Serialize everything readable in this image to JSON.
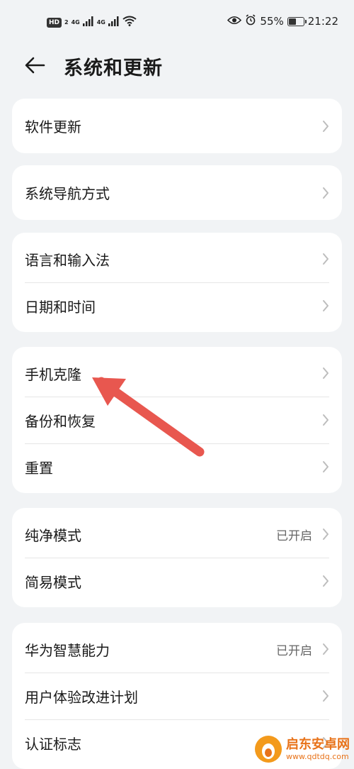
{
  "status": {
    "hd_label": "HD",
    "hd_num": "2",
    "sig1_label": "4G",
    "sig2_label": "4G",
    "battery_pct": "55%",
    "battery_level": 0.55,
    "time": "21:22"
  },
  "header": {
    "title": "系统和更新"
  },
  "groups": [
    {
      "items": [
        {
          "label": "软件更新"
        }
      ]
    },
    {
      "items": [
        {
          "label": "系统导航方式"
        }
      ]
    },
    {
      "items": [
        {
          "label": "语言和输入法"
        },
        {
          "label": "日期和时间"
        }
      ]
    },
    {
      "items": [
        {
          "label": "手机克隆"
        },
        {
          "label": "备份和恢复"
        },
        {
          "label": "重置"
        }
      ]
    },
    {
      "items": [
        {
          "label": "纯净模式",
          "value": "已开启"
        },
        {
          "label": "简易模式"
        }
      ]
    },
    {
      "items": [
        {
          "label": "华为智慧能力",
          "value": "已开启"
        },
        {
          "label": "用户体验改进计划"
        },
        {
          "label": "认证标志"
        }
      ]
    }
  ],
  "annotation": {
    "color": "#e8574f"
  },
  "watermark": {
    "name": "启东安卓网",
    "url": "www.qdtdq.com"
  },
  "icons": {
    "back": "arrow-left-icon",
    "chevron": "chevron-right-icon",
    "eye": "eye-icon",
    "alarm": "alarm-icon",
    "wifi": "wifi-icon",
    "battery": "battery-icon"
  }
}
